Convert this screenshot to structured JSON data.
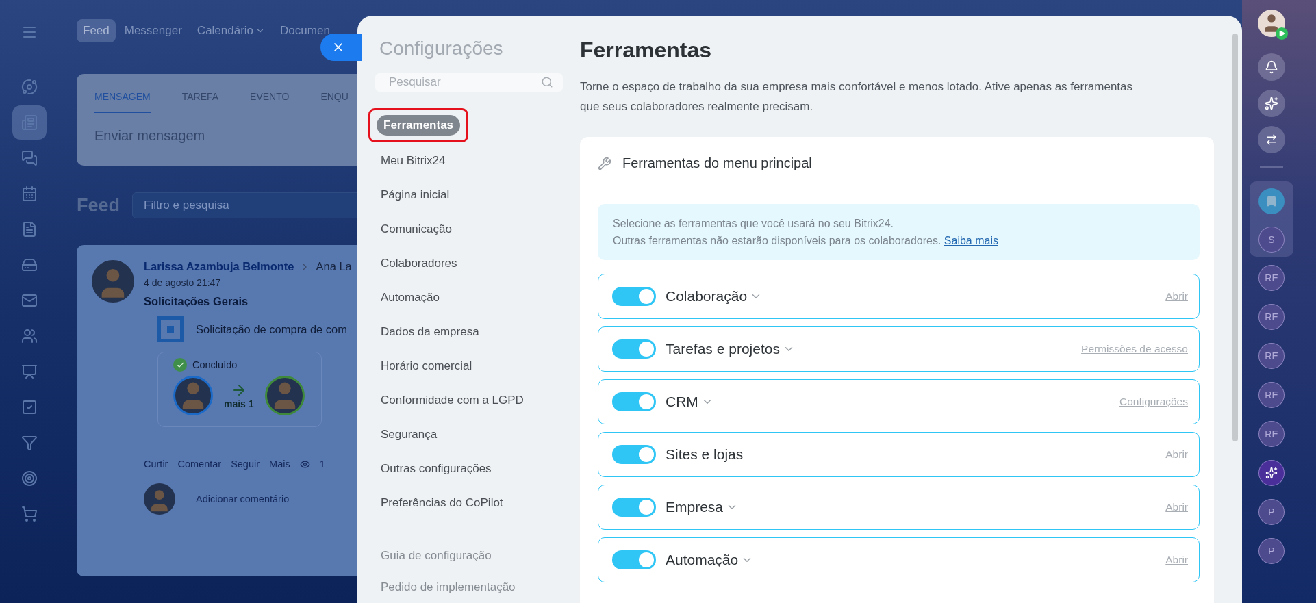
{
  "app": {
    "left_rail": [
      {
        "kind": "pulse",
        "selected": false
      },
      {
        "kind": "feed",
        "selected": true
      },
      {
        "kind": "chat",
        "selected": false
      },
      {
        "kind": "calendar",
        "selected": false
      },
      {
        "kind": "document",
        "selected": false
      },
      {
        "kind": "drive",
        "selected": false
      },
      {
        "kind": "mail",
        "selected": false
      },
      {
        "kind": "people",
        "selected": false
      },
      {
        "kind": "board",
        "selected": false
      },
      {
        "kind": "task",
        "selected": false
      },
      {
        "kind": "funnel",
        "selected": false
      },
      {
        "kind": "target",
        "selected": false
      },
      {
        "kind": "cart",
        "selected": false
      }
    ],
    "nav": [
      {
        "label": "Feed",
        "selected": true,
        "dropdown": false
      },
      {
        "label": "Messenger",
        "selected": false,
        "dropdown": false
      },
      {
        "label": "Calendário",
        "selected": false,
        "dropdown": true
      },
      {
        "label": "Documen",
        "selected": false,
        "dropdown": false
      }
    ],
    "composer": {
      "tabs": [
        {
          "label": "MENSAGEM",
          "selected": true
        },
        {
          "label": "TAREFA",
          "selected": false
        },
        {
          "label": "EVENTO",
          "selected": false
        },
        {
          "label": "ENQU",
          "selected": false
        }
      ],
      "placeholder": "Enviar mensagem"
    },
    "feed": {
      "title": "Feed",
      "filter_placeholder": "Filtro e pesquisa"
    },
    "post": {
      "author": "Larissa Azambuja Belmonte",
      "recipient": "Ana La",
      "date": "4 de agosto 21:47",
      "title": "Solicitações Gerais",
      "item": "Solicitação de compra de com",
      "status": "Concluído",
      "flow_label": "mais 1",
      "actions": [
        "Curtir",
        "Comentar",
        "Seguir",
        "Mais"
      ],
      "views": "1",
      "comment_placeholder": "Adicionar comentário"
    }
  },
  "settings": {
    "title": "Configurações",
    "search_placeholder": "Pesquisar",
    "items": [
      {
        "label": "Ferramentas",
        "selected": true,
        "annotated": true
      },
      {
        "label": "Meu Bitrix24",
        "selected": false,
        "annotated": false
      },
      {
        "label": "Página inicial",
        "selected": false,
        "annotated": false
      },
      {
        "label": "Comunicação",
        "selected": false,
        "annotated": false
      },
      {
        "label": "Colaboradores",
        "selected": false,
        "annotated": false
      },
      {
        "label": "Automação",
        "selected": false,
        "annotated": false
      },
      {
        "label": "Dados da empresa",
        "selected": false,
        "annotated": false
      },
      {
        "label": "Horário comercial",
        "selected": false,
        "annotated": false
      },
      {
        "label": "Conformidade com a LGPD",
        "selected": false,
        "annotated": false
      },
      {
        "label": "Segurança",
        "selected": false,
        "annotated": false
      },
      {
        "label": "Outras configurações",
        "selected": false,
        "annotated": false
      },
      {
        "label": "Preferências do CoPilot",
        "selected": false,
        "annotated": false
      }
    ],
    "footer_items": [
      "Guia de configuração",
      "Pedido de implementação"
    ]
  },
  "content": {
    "title": "Ferramentas",
    "description": "Torne o espaço de trabalho da sua empresa mais confortável e menos lotado. Ative apenas as ferramentas que seus colaboradores realmente precisam.",
    "card": {
      "title": "Ferramentas do menu principal",
      "info": {
        "line_1": "Selecione as ferramentas que você usará no seu Bitrix24.",
        "line_2": "Outras ferramentas não estarão disponíveis para os colaboradores.",
        "link": "Saiba mais"
      },
      "tools": [
        {
          "name": "Colaboração",
          "on": true,
          "expandable": true,
          "action": "Abrir"
        },
        {
          "name": "Tarefas e projetos",
          "on": true,
          "expandable": true,
          "action": "Permissões de acesso"
        },
        {
          "name": "CRM",
          "on": true,
          "expandable": true,
          "action": "Configurações"
        },
        {
          "name": "Sites e lojas",
          "on": true,
          "expandable": false,
          "action": "Abrir"
        },
        {
          "name": "Empresa",
          "on": true,
          "expandable": true,
          "action": "Abrir"
        },
        {
          "name": "Automação",
          "on": true,
          "expandable": true,
          "action": "Abrir"
        }
      ]
    }
  },
  "right_rail": [
    {
      "kind": "avatar"
    },
    {
      "kind": "bell"
    },
    {
      "kind": "copilot"
    },
    {
      "kind": "exchange"
    },
    {
      "kind": "separator"
    },
    {
      "kind": "bookmark",
      "pinned": true
    },
    {
      "kind": "letter",
      "text": "S",
      "pinned": true
    },
    {
      "kind": "letter",
      "text": "RE",
      "pinned": false
    },
    {
      "kind": "letter",
      "text": "RE",
      "pinned": false
    },
    {
      "kind": "letter",
      "text": "RE",
      "pinned": false
    },
    {
      "kind": "letter",
      "text": "RE",
      "pinned": false
    },
    {
      "kind": "letter",
      "text": "RE",
      "pinned": false
    },
    {
      "kind": "copilot_round",
      "pinned": false
    },
    {
      "kind": "letter",
      "text": "P",
      "pinned": false
    },
    {
      "kind": "letter",
      "text": "P",
      "pinned": false
    }
  ]
}
